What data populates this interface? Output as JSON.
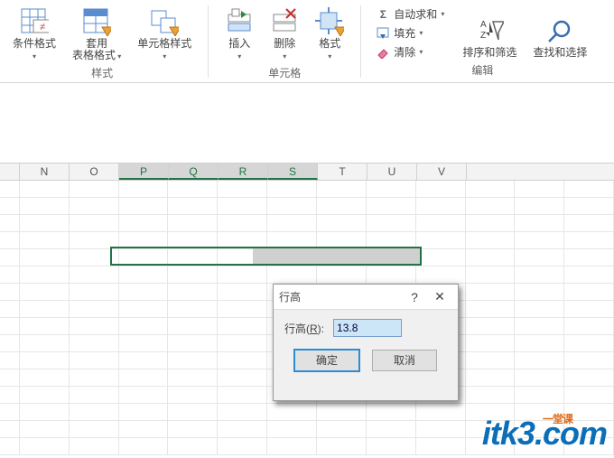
{
  "ribbon": {
    "styles": {
      "label": "样式",
      "conditional": "条件格式",
      "tableFormat": "套用\n表格格式",
      "cellStyles": "单元格样式"
    },
    "cells": {
      "label": "单元格",
      "insert": "插入",
      "delete": "删除",
      "format": "格式"
    },
    "editing": {
      "label": "编辑",
      "autosum": "自动求和",
      "fill": "填充",
      "clear": "清除",
      "sortFilter": "排序和筛选",
      "findSelect": "查找和选择"
    }
  },
  "columns": [
    "N",
    "O",
    "P",
    "Q",
    "R",
    "S",
    "T",
    "U",
    "V"
  ],
  "selectedCols": [
    "P",
    "Q",
    "R",
    "S"
  ],
  "dialog": {
    "title": "行高",
    "fieldLabel": "行高(R):",
    "value": "13.8",
    "ok": "确定",
    "cancel": "取消"
  },
  "watermark": {
    "text": "itk3",
    "suffix": ".com",
    "tag": "一堂课"
  }
}
